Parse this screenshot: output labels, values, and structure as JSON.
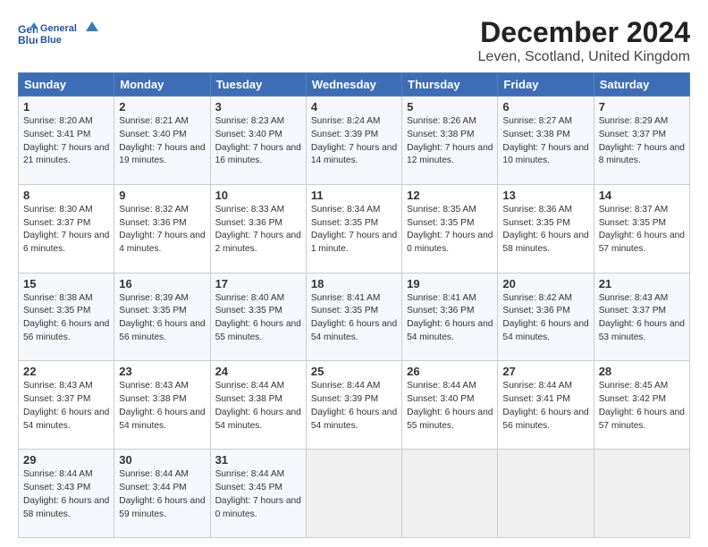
{
  "logo": {
    "line1": "General",
    "line2": "Blue"
  },
  "title": "December 2024",
  "subtitle": "Leven, Scotland, United Kingdom",
  "days_header": [
    "Sunday",
    "Monday",
    "Tuesday",
    "Wednesday",
    "Thursday",
    "Friday",
    "Saturday"
  ],
  "weeks": [
    [
      {
        "day": "1",
        "sunrise": "Sunrise: 8:20 AM",
        "sunset": "Sunset: 3:41 PM",
        "daylight": "Daylight: 7 hours and 21 minutes."
      },
      {
        "day": "2",
        "sunrise": "Sunrise: 8:21 AM",
        "sunset": "Sunset: 3:40 PM",
        "daylight": "Daylight: 7 hours and 19 minutes."
      },
      {
        "day": "3",
        "sunrise": "Sunrise: 8:23 AM",
        "sunset": "Sunset: 3:40 PM",
        "daylight": "Daylight: 7 hours and 16 minutes."
      },
      {
        "day": "4",
        "sunrise": "Sunrise: 8:24 AM",
        "sunset": "Sunset: 3:39 PM",
        "daylight": "Daylight: 7 hours and 14 minutes."
      },
      {
        "day": "5",
        "sunrise": "Sunrise: 8:26 AM",
        "sunset": "Sunset: 3:38 PM",
        "daylight": "Daylight: 7 hours and 12 minutes."
      },
      {
        "day": "6",
        "sunrise": "Sunrise: 8:27 AM",
        "sunset": "Sunset: 3:38 PM",
        "daylight": "Daylight: 7 hours and 10 minutes."
      },
      {
        "day": "7",
        "sunrise": "Sunrise: 8:29 AM",
        "sunset": "Sunset: 3:37 PM",
        "daylight": "Daylight: 7 hours and 8 minutes."
      }
    ],
    [
      {
        "day": "8",
        "sunrise": "Sunrise: 8:30 AM",
        "sunset": "Sunset: 3:37 PM",
        "daylight": "Daylight: 7 hours and 6 minutes."
      },
      {
        "day": "9",
        "sunrise": "Sunrise: 8:32 AM",
        "sunset": "Sunset: 3:36 PM",
        "daylight": "Daylight: 7 hours and 4 minutes."
      },
      {
        "day": "10",
        "sunrise": "Sunrise: 8:33 AM",
        "sunset": "Sunset: 3:36 PM",
        "daylight": "Daylight: 7 hours and 2 minutes."
      },
      {
        "day": "11",
        "sunrise": "Sunrise: 8:34 AM",
        "sunset": "Sunset: 3:35 PM",
        "daylight": "Daylight: 7 hours and 1 minute."
      },
      {
        "day": "12",
        "sunrise": "Sunrise: 8:35 AM",
        "sunset": "Sunset: 3:35 PM",
        "daylight": "Daylight: 7 hours and 0 minutes."
      },
      {
        "day": "13",
        "sunrise": "Sunrise: 8:36 AM",
        "sunset": "Sunset: 3:35 PM",
        "daylight": "Daylight: 6 hours and 58 minutes."
      },
      {
        "day": "14",
        "sunrise": "Sunrise: 8:37 AM",
        "sunset": "Sunset: 3:35 PM",
        "daylight": "Daylight: 6 hours and 57 minutes."
      }
    ],
    [
      {
        "day": "15",
        "sunrise": "Sunrise: 8:38 AM",
        "sunset": "Sunset: 3:35 PM",
        "daylight": "Daylight: 6 hours and 56 minutes."
      },
      {
        "day": "16",
        "sunrise": "Sunrise: 8:39 AM",
        "sunset": "Sunset: 3:35 PM",
        "daylight": "Daylight: 6 hours and 56 minutes."
      },
      {
        "day": "17",
        "sunrise": "Sunrise: 8:40 AM",
        "sunset": "Sunset: 3:35 PM",
        "daylight": "Daylight: 6 hours and 55 minutes."
      },
      {
        "day": "18",
        "sunrise": "Sunrise: 8:41 AM",
        "sunset": "Sunset: 3:35 PM",
        "daylight": "Daylight: 6 hours and 54 minutes."
      },
      {
        "day": "19",
        "sunrise": "Sunrise: 8:41 AM",
        "sunset": "Sunset: 3:36 PM",
        "daylight": "Daylight: 6 hours and 54 minutes."
      },
      {
        "day": "20",
        "sunrise": "Sunrise: 8:42 AM",
        "sunset": "Sunset: 3:36 PM",
        "daylight": "Daylight: 6 hours and 54 minutes."
      },
      {
        "day": "21",
        "sunrise": "Sunrise: 8:43 AM",
        "sunset": "Sunset: 3:37 PM",
        "daylight": "Daylight: 6 hours and 53 minutes."
      }
    ],
    [
      {
        "day": "22",
        "sunrise": "Sunrise: 8:43 AM",
        "sunset": "Sunset: 3:37 PM",
        "daylight": "Daylight: 6 hours and 54 minutes."
      },
      {
        "day": "23",
        "sunrise": "Sunrise: 8:43 AM",
        "sunset": "Sunset: 3:38 PM",
        "daylight": "Daylight: 6 hours and 54 minutes."
      },
      {
        "day": "24",
        "sunrise": "Sunrise: 8:44 AM",
        "sunset": "Sunset: 3:38 PM",
        "daylight": "Daylight: 6 hours and 54 minutes."
      },
      {
        "day": "25",
        "sunrise": "Sunrise: 8:44 AM",
        "sunset": "Sunset: 3:39 PM",
        "daylight": "Daylight: 6 hours and 54 minutes."
      },
      {
        "day": "26",
        "sunrise": "Sunrise: 8:44 AM",
        "sunset": "Sunset: 3:40 PM",
        "daylight": "Daylight: 6 hours and 55 minutes."
      },
      {
        "day": "27",
        "sunrise": "Sunrise: 8:44 AM",
        "sunset": "Sunset: 3:41 PM",
        "daylight": "Daylight: 6 hours and 56 minutes."
      },
      {
        "day": "28",
        "sunrise": "Sunrise: 8:45 AM",
        "sunset": "Sunset: 3:42 PM",
        "daylight": "Daylight: 6 hours and 57 minutes."
      }
    ],
    [
      {
        "day": "29",
        "sunrise": "Sunrise: 8:44 AM",
        "sunset": "Sunset: 3:43 PM",
        "daylight": "Daylight: 6 hours and 58 minutes."
      },
      {
        "day": "30",
        "sunrise": "Sunrise: 8:44 AM",
        "sunset": "Sunset: 3:44 PM",
        "daylight": "Daylight: 6 hours and 59 minutes."
      },
      {
        "day": "31",
        "sunrise": "Sunrise: 8:44 AM",
        "sunset": "Sunset: 3:45 PM",
        "daylight": "Daylight: 7 hours and 0 minutes."
      },
      null,
      null,
      null,
      null
    ]
  ]
}
